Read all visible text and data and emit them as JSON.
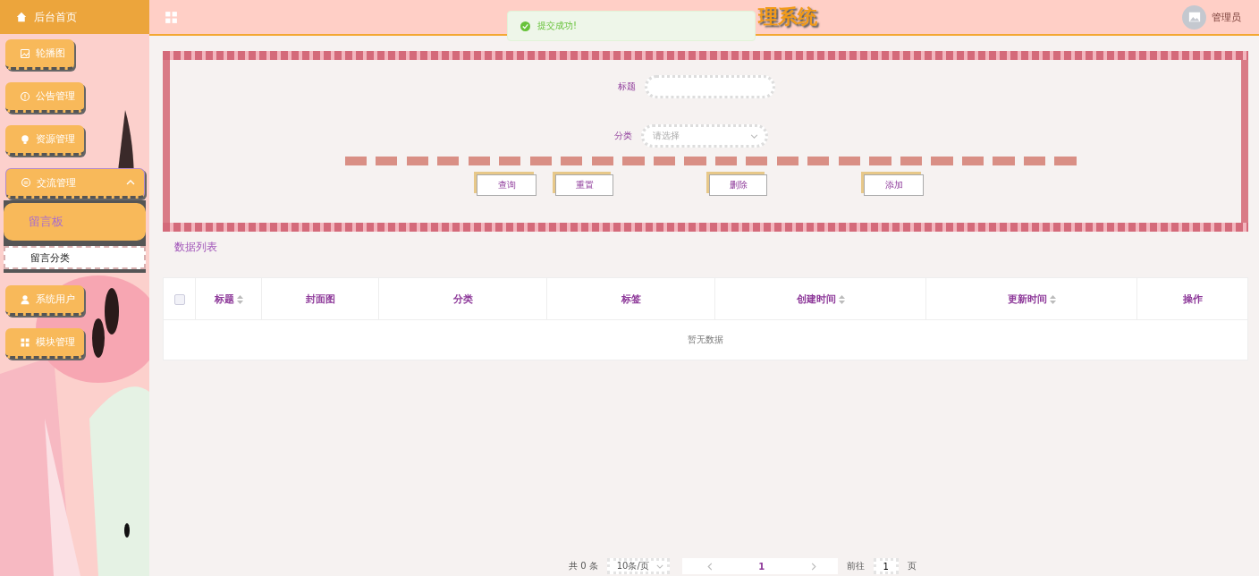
{
  "header": {
    "title": "理系统",
    "user": "管理员"
  },
  "toast": {
    "message": "提交成功!"
  },
  "sidebar": {
    "home": "后台首页",
    "items": [
      {
        "label": "轮播图",
        "expanded": false
      },
      {
        "label": "公告管理",
        "expanded": false
      },
      {
        "label": "资源管理",
        "expanded": false
      },
      {
        "label": "交流管理",
        "expanded": true,
        "children": [
          {
            "label": "留言板",
            "selected": true
          },
          {
            "label": "留言分类",
            "selected": false
          }
        ]
      },
      {
        "label": "系统用户",
        "expanded": false
      },
      {
        "label": "模块管理",
        "expanded": false
      }
    ]
  },
  "search": {
    "fields": [
      {
        "kind": "text",
        "label": "标题"
      },
      {
        "kind": "select",
        "label": "分类",
        "placeholder": "请选择"
      }
    ],
    "buttons": [
      "查询",
      "重置",
      "删除",
      "添加"
    ]
  },
  "table": {
    "title": "数据列表",
    "select_all": {
      "checked": false
    },
    "columns": [
      {
        "label": "标题",
        "sortable": true
      },
      {
        "label": "封面图",
        "sortable": false
      },
      {
        "label": "分类",
        "sortable": false
      },
      {
        "label": "标签",
        "sortable": false
      },
      {
        "label": "创建时间",
        "sortable": true
      },
      {
        "label": "更新时间",
        "sortable": true
      },
      {
        "label": "操作",
        "sortable": false
      }
    ],
    "empty_text": "暂无数据"
  },
  "pagination": {
    "total": "共 0 条",
    "page_size": "10条/页",
    "pages": [
      {
        "label": "1",
        "selected": true
      }
    ],
    "goto_label": "前往",
    "goto_value": "1",
    "page_unit": "页"
  }
}
